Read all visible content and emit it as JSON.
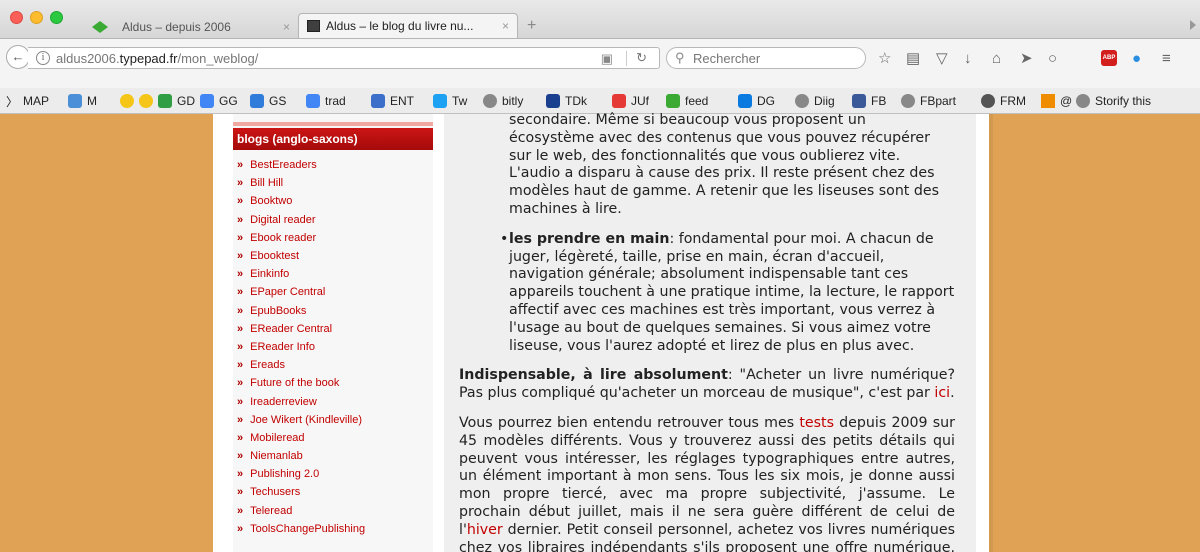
{
  "browser": {
    "tabs": [
      {
        "title": "Aldus – depuis 2006"
      },
      {
        "title": "Aldus – le blog du livre nu..."
      }
    ],
    "new_tab_label": "+",
    "tab_close_glyph": "×",
    "url_host": "aldus2006.",
    "url_domain": "typepad.fr",
    "url_path": "/mon_weblog/",
    "search_placeholder": "Rechercher",
    "bookmarks": [
      {
        "label": "MAP",
        "color": "#444444"
      },
      {
        "label": "M",
        "color": "#4a8fd8"
      },
      {
        "label": "",
        "color": "#f5c518"
      },
      {
        "label": "GD",
        "color": "#2f9e44"
      },
      {
        "label": "GG",
        "color": "#4285f4"
      },
      {
        "label": "GS",
        "color": "#2f7cdb"
      },
      {
        "label": "trad",
        "color": "#4285f4"
      },
      {
        "label": "ENT",
        "color": "#3b6fc9"
      },
      {
        "label": "Tw",
        "color": "#1da1f2"
      },
      {
        "label": "bitly",
        "color": "#888888"
      },
      {
        "label": "TDk",
        "color": "#1a3f8f"
      },
      {
        "label": "JUf",
        "color": "#e53935"
      },
      {
        "label": "feed",
        "color": "#3aaa35"
      },
      {
        "label": "DG",
        "color": "#0a7ae0"
      },
      {
        "label": "Diig",
        "color": "#888888"
      },
      {
        "label": "FB",
        "color": "#3b5998"
      },
      {
        "label": "FBpart",
        "color": "#888888"
      },
      {
        "label": "FRM",
        "color": "#555555"
      },
      {
        "label": "@",
        "color": "#f08c00"
      },
      {
        "label": "Storify this",
        "color": "#888888"
      }
    ]
  },
  "sidebar": {
    "header": "blogs (anglo-saxons)",
    "bullet": "»",
    "items": [
      "BestEreaders",
      "Bill Hill",
      "Booktwo",
      "Digital reader",
      "Ebook reader",
      "Ebooktest",
      "Einkinfo",
      "EPaper Central",
      "EpubBooks",
      "EReader Central",
      "EReader Info",
      "Ereads",
      "Future of the book",
      "Ireaderreview",
      "Joe Wikert (Kindleville)",
      "Mobileread",
      "Niemanlab",
      "Publishing 2.0",
      "Techusers",
      "Teleread",
      "ToolsChangePublishing"
    ]
  },
  "article": {
    "cont_lines": "secondaire. Même si beaucoup vous proposent un écosystème avec des contenus que vous pouvez récupérer sur le web, des fonctionnalités que vous oublierez vite. L'audio a disparu à cause des prix. Il reste présent chez des modèles haut de gamme. A retenir que les liseuses sont des machines à lire.",
    "bullet_bold": "les prendre en main",
    "bullet_text": ": fondamental pour moi. A chacun de juger, légèreté, taille, prise en main, écran d'accueil, navigation générale; absolument indispensable tant ces appareils touchent à une pratique intime, la lecture, le rapport affectif avec ces machines est très important, vous verrez à l'usage au bout de quelques semaines. Si vous aimez votre liseuse, vous l'aurez adopté et lirez de plus en plus avec.",
    "p1_bold": "Indispensable, à lire absolument",
    "p1_text": ": \"Acheter un livre numérique? Pas plus compliqué qu'acheter un morceau de musique\", c'est par ",
    "p1_link": "ici",
    "p1_end": ".",
    "p2_a": "Vous pourrez bien entendu retrouver tous mes ",
    "p2_link1": "tests",
    "p2_b": " depuis 2009 sur 45 modèles différents. Vous y trouverez aussi des petits détails qui peuvent vous intéresser, les réglages typographiques entre autres, un élément important à mon sens. Tous les six mois, je donne aussi mon propre tiercé, avec ma propre subjectivité, j'assume. Le prochain début juillet, mais il ne sera guère différent de celui de l'",
    "p2_link2": "hiver",
    "p2_c": " dernier. Petit conseil personnel, achetez vos livres numériques chez vos libraires indépendants s'ils proposent une offre numérique. Chetez vos jours pour il y a des prix fait vous le pourrez des rendu..."
  }
}
